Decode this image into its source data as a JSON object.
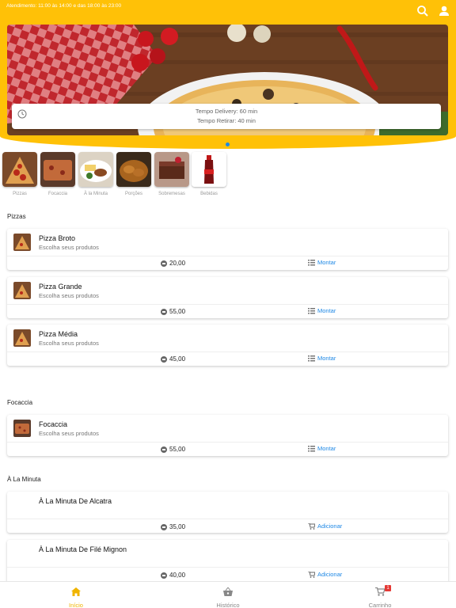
{
  "header": {
    "hours": "Atendimento: 11:00 às 14:00 e das 18:00 às 23:00",
    "search_icon": "search-icon",
    "account_icon": "account-icon",
    "accent_color": "#ffc107"
  },
  "banner": {
    "delivery_time": "Tempo Delivery: 60 min",
    "pickup_time": "Tempo Retirar: 40 min"
  },
  "categories": [
    {
      "label": "Pizzas"
    },
    {
      "label": "Focaccia"
    },
    {
      "label": "À la Minuta"
    },
    {
      "label": "Porções"
    },
    {
      "label": "Sobremesas"
    },
    {
      "label": "Bebidas"
    }
  ],
  "sections": {
    "pizzas": {
      "title": "Pizzas",
      "items": [
        {
          "name": "Pizza Broto",
          "desc": "Escolha seus produtos",
          "price": "20,00",
          "action": "Montar"
        },
        {
          "name": "Pizza Grande",
          "desc": "Escolha seus produtos",
          "price": "55,00",
          "action": "Montar"
        },
        {
          "name": "Pizza Média",
          "desc": "Escolha seus produtos",
          "price": "45,00",
          "action": "Montar"
        }
      ]
    },
    "focaccia": {
      "title": "Focaccia",
      "items": [
        {
          "name": "Focaccia",
          "desc": "Escolha seus produtos",
          "price": "55,00",
          "action": "Montar"
        }
      ]
    },
    "minuta": {
      "title": "À La Minuta",
      "items": [
        {
          "name": "À La Minuta De Alcatra",
          "price": "35,00",
          "action": "Adicionar"
        },
        {
          "name": "À La Minuta De Filé Mignon",
          "price": "40,00",
          "action": "Adicionar"
        }
      ]
    }
  },
  "bottom_nav": {
    "home": "Início",
    "history": "Histórico",
    "cart": "Carrinho",
    "cart_count": "1"
  }
}
